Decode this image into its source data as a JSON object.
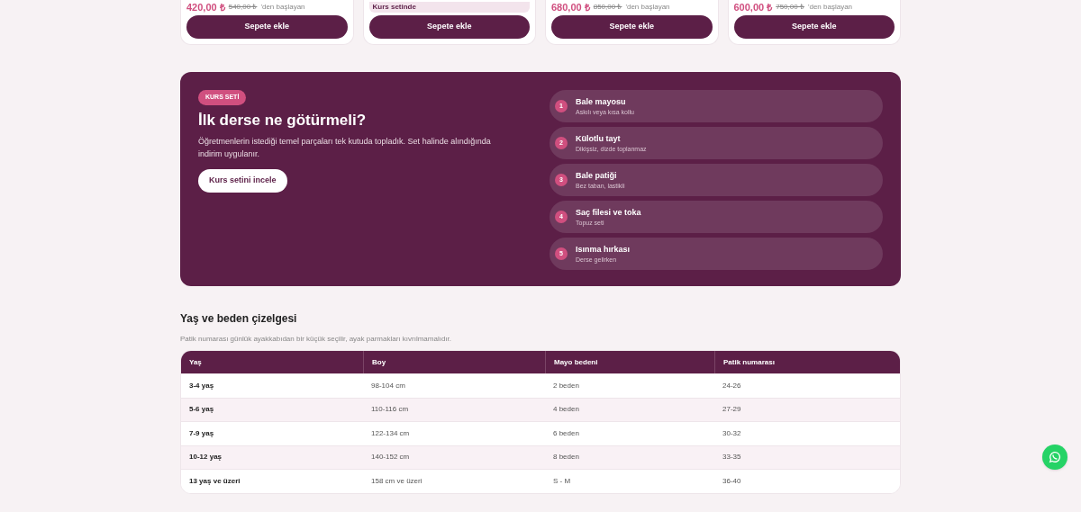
{
  "product_cards": [
    {
      "price": "420,00 ₺",
      "old_price": "540,00 ₺",
      "price_suffix": "'den başlayan",
      "button": "Sepete ekle"
    },
    {
      "badge": "Kurs setinde",
      "button": "Sepete ekle"
    },
    {
      "price": "680,00 ₺",
      "old_price": "850,00 ₺",
      "price_suffix": "'den başlayan",
      "button": "Sepete ekle"
    },
    {
      "price": "600,00 ₺",
      "old_price": "750,00 ₺",
      "price_suffix": "'den başlayan",
      "button": "Sepete ekle"
    }
  ],
  "course_set": {
    "tag": "KURS SETİ",
    "title": "İlk derse ne götürmeli?",
    "description": "Öğretmenlerin istediği temel parçaları tek kutuda topladık. Set halinde alındığında indirim uygulanır.",
    "button": "Kurs setini incele",
    "items": [
      {
        "number": "1",
        "name": "Bale mayosu",
        "note": "Askılı veya kısa kollu"
      },
      {
        "number": "2",
        "name": "Külotlu tayt",
        "note": "Dikişsiz, dizde toplanmaz"
      },
      {
        "number": "3",
        "name": "Bale patiği",
        "note": "Bez taban, lastikli"
      },
      {
        "number": "4",
        "name": "Saç filesi ve toka",
        "note": "Topuz seti"
      },
      {
        "number": "5",
        "name": "Isınma hırkası",
        "note": "Derse gelirken"
      }
    ]
  },
  "size_chart": {
    "title": "Yaş ve beden çizelgesi",
    "note": "Patik numarası günlük ayakkabıdan bir küçük seçilir, ayak parmakları kıvrılmamalıdır.",
    "columns": [
      "Yaş",
      "Boy",
      "Mayo bedeni",
      "Patik numarası"
    ],
    "rows": [
      [
        "3-4 yaş",
        "98-104 cm",
        "2 beden",
        "24-26"
      ],
      [
        "5-6 yaş",
        "110-116 cm",
        "4 beden",
        "27-29"
      ],
      [
        "7-9 yaş",
        "122-134 cm",
        "6 beden",
        "30-32"
      ],
      [
        "10-12 yaş",
        "140-152 cm",
        "8 beden",
        "33-35"
      ],
      [
        "13 yaş ve üzeri",
        "158 cm ve üzeri",
        "S - M",
        "36-40"
      ]
    ]
  }
}
